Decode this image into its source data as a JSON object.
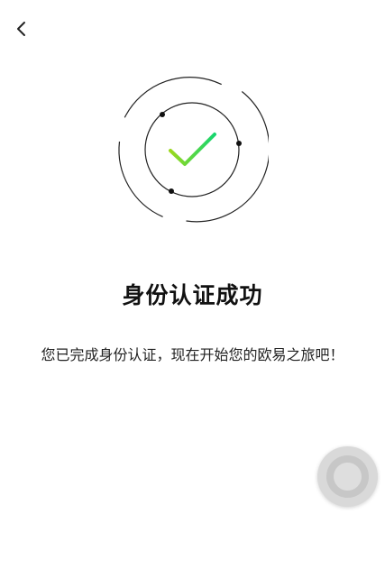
{
  "header": {
    "back_icon": "chevron-left-icon"
  },
  "illustration": {
    "icon": "checkmark-icon",
    "check_gradient": [
      "#9bd81d",
      "#16d66f"
    ]
  },
  "main": {
    "title": "身份认证成功",
    "message": "您已完成身份认证，现在开始您的欧易之旅吧！"
  },
  "floating_button": {
    "icon": "assistive-touch-icon"
  }
}
